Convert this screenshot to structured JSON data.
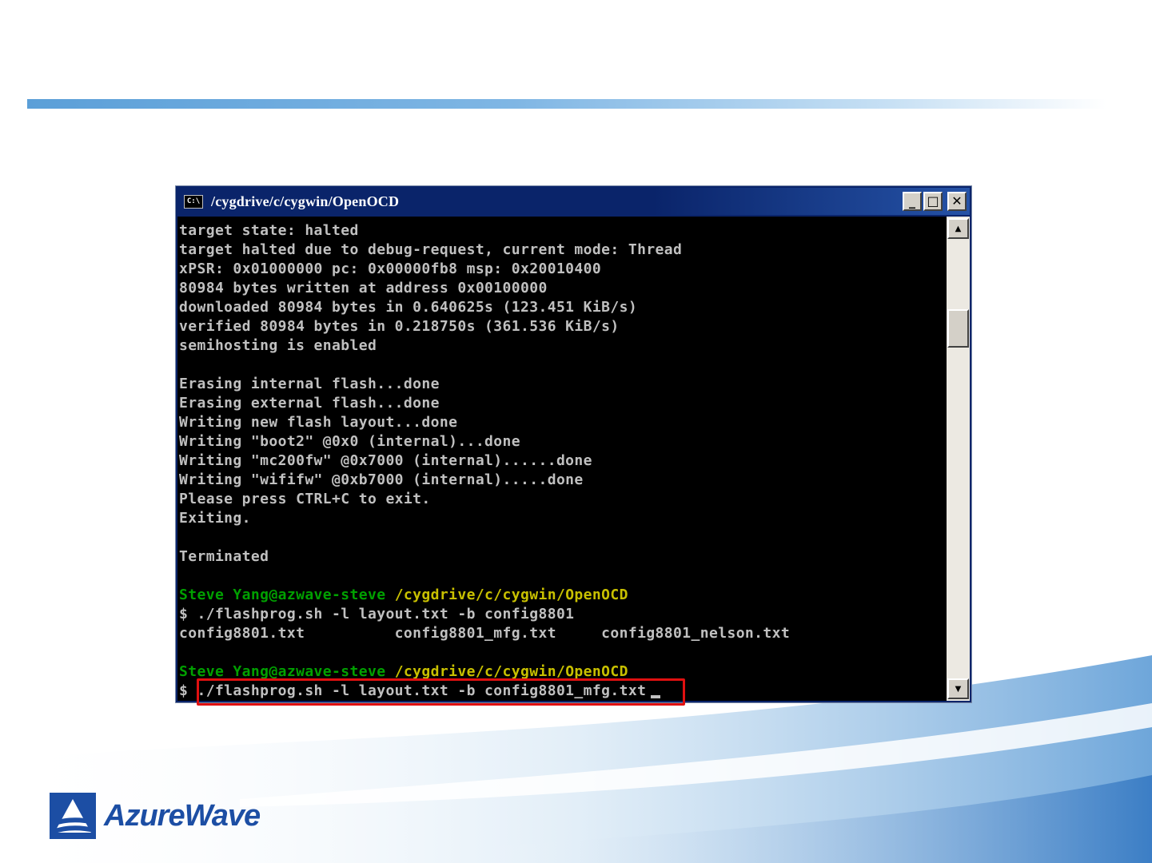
{
  "window": {
    "title": "/cygdrive/c/cygwin/OpenOCD",
    "icon_text": "C:\\",
    "minimize_glyph": "_",
    "maximize_glyph": "□",
    "close_glyph": "✕"
  },
  "console_lines": [
    "target state: halted",
    "target halted due to debug-request, current mode: Thread",
    "xPSR: 0x01000000 pc: 0x00000fb8 msp: 0x20010400",
    "80984 bytes written at address 0x00100000",
    "downloaded 80984 bytes in 0.640625s (123.451 KiB/s)",
    "verified 80984 bytes in 0.218750s (361.536 KiB/s)",
    "semihosting is enabled",
    "",
    "Erasing internal flash...done",
    "Erasing external flash...done",
    "Writing new flash layout...done",
    "Writing \"boot2\" @0x0 (internal)...done",
    "Writing \"mc200fw\" @0x7000 (internal)......done",
    "Writing \"wififw\" @0xb7000 (internal).....done",
    "Please press CTRL+C to exit.",
    "Exiting.",
    "",
    "Terminated",
    "",
    "PROMPT",
    "$ ./flashprog.sh -l layout.txt -b config8801",
    "config8801.txt          config8801_mfg.txt     config8801_nelson.txt",
    "",
    "PROMPT",
    "$ ./flashprog.sh -l layout.txt -b config8801_mfg.txt"
  ],
  "prompt": {
    "user_host": "Steve Yang@azwave-steve",
    "path": "/cygdrive/c/cygwin/OpenOCD"
  },
  "scrollbar": {
    "up_glyph": "▲",
    "down_glyph": "▼"
  },
  "brand": {
    "name": "AzureWave",
    "color": "#1c4ea4"
  },
  "colors": {
    "console_bg": "#000000",
    "console_text": "#c0c0c0",
    "prompt_user": "#00a000",
    "prompt_path": "#c8c000",
    "highlight": "#e01010"
  }
}
